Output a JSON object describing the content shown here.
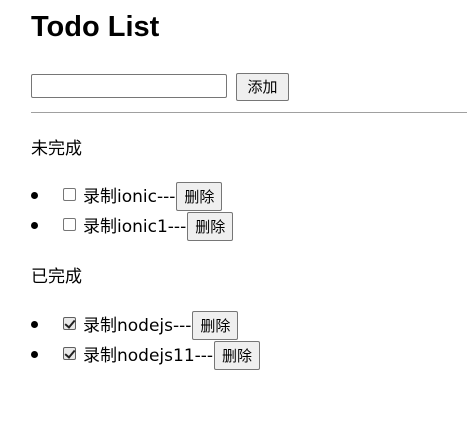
{
  "title": "Todo List",
  "input": {
    "value": "",
    "placeholder": ""
  },
  "add_button": {
    "label": "添加"
  },
  "sections": {
    "incomplete": {
      "heading": "未完成",
      "items": [
        {
          "text": "录制ionic",
          "separator": "---",
          "delete_label": "删除",
          "checked": false
        },
        {
          "text": "录制ionic1",
          "separator": "---",
          "delete_label": "删除",
          "checked": false
        }
      ]
    },
    "complete": {
      "heading": "已完成",
      "items": [
        {
          "text": "录制nodejs",
          "separator": "---",
          "delete_label": "删除",
          "checked": true
        },
        {
          "text": "录制nodejs11",
          "separator": "---",
          "delete_label": "删除",
          "checked": true
        }
      ]
    }
  }
}
